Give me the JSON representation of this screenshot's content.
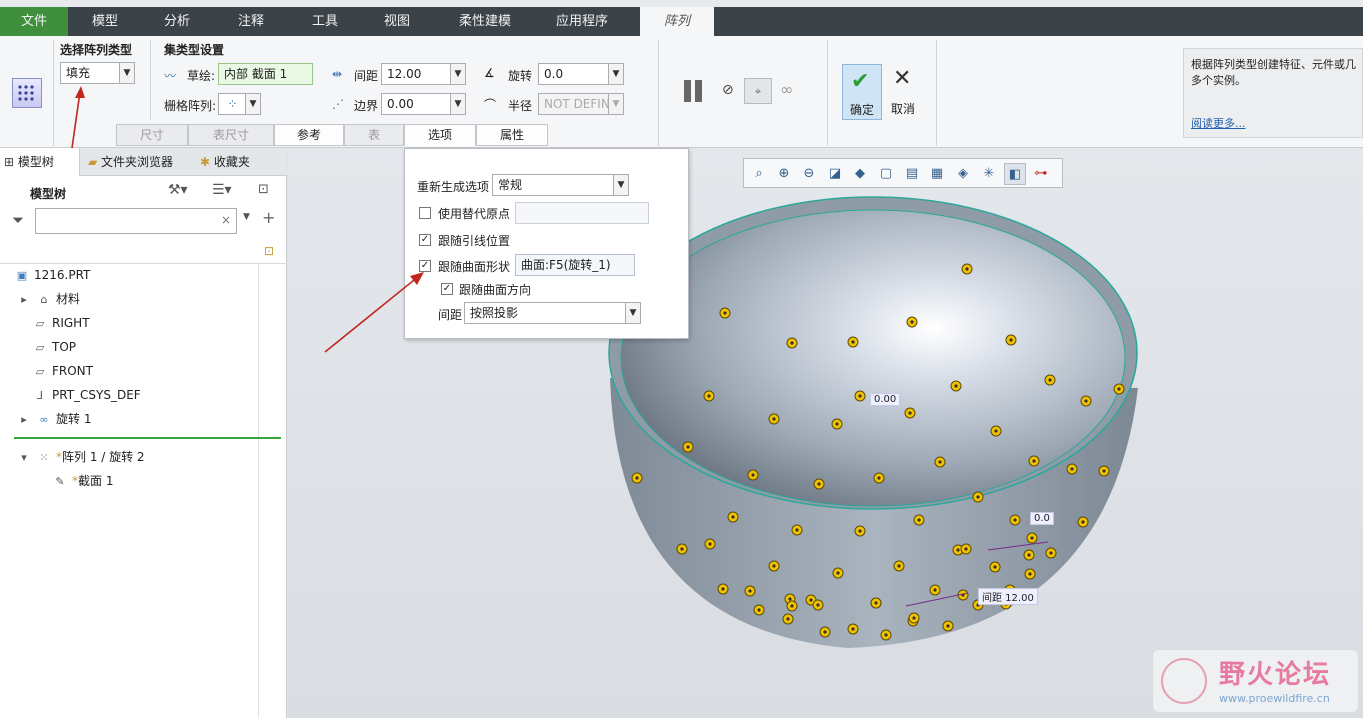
{
  "menu": {
    "tabs": [
      "文件",
      "模型",
      "分析",
      "注释",
      "工具",
      "视图",
      "柔性建模",
      "应用程序",
      "阵列"
    ]
  },
  "ribbon": {
    "type_group_label": "选择阵列类型",
    "type_value": "填充",
    "set_group_label": "集类型设置",
    "sketch_label": "草绘:",
    "sketch_value": "内部 截面 1",
    "grid_label": "栅格阵列:",
    "spacing_label": "间距",
    "spacing_value": "12.00",
    "border_label": "边界",
    "border_value": "0.00",
    "rotate_label": "旋转",
    "rotate_value": "0.0",
    "radius_label": "半径",
    "radius_value": "NOT DEFIN",
    "ok_label": "确定",
    "cancel_label": "取消",
    "subtabs": [
      "尺寸",
      "表尺寸",
      "参考",
      "表",
      "选项",
      "属性"
    ]
  },
  "help": {
    "text": "根据阵列类型创建特征、元件或几多个实例。",
    "link": "阅读更多..."
  },
  "left_panel": {
    "tabs": [
      "模型树",
      "文件夹浏览器",
      "收藏夹"
    ],
    "tree_title": "模型树",
    "items": [
      "1216.PRT",
      "材料",
      "RIGHT",
      "TOP",
      "FRONT",
      "PRT_CSYS_DEF",
      "旋转 1",
      "阵列 1 / 旋转 2",
      "截面 1"
    ]
  },
  "options_popup": {
    "regen_label": "重新生成选项",
    "regen_value": "常规",
    "alt_origin_label": "使用替代原点",
    "follow_leader_label": "跟随引线位置",
    "follow_surface_shape_label": "跟随曲面形状",
    "surface_value": "曲面:F5(旋转_1)",
    "follow_surface_dir_label": "跟随曲面方向",
    "spacing_label": "间距",
    "spacing_value": "按照投影"
  },
  "viewport": {
    "dim_angle": "0.00",
    "dim_rotate": "0.0",
    "dim_spacing": "间距 12.00"
  },
  "watermark": {
    "title": "野火论坛",
    "url": "www.proewildfire.cn"
  },
  "colors": {
    "file_tab": "#3f8f3d",
    "menubar": "#3b4248",
    "bowl_rim": "#2aa89a",
    "dot": "#f2c200",
    "arrow": "#c0271f"
  }
}
